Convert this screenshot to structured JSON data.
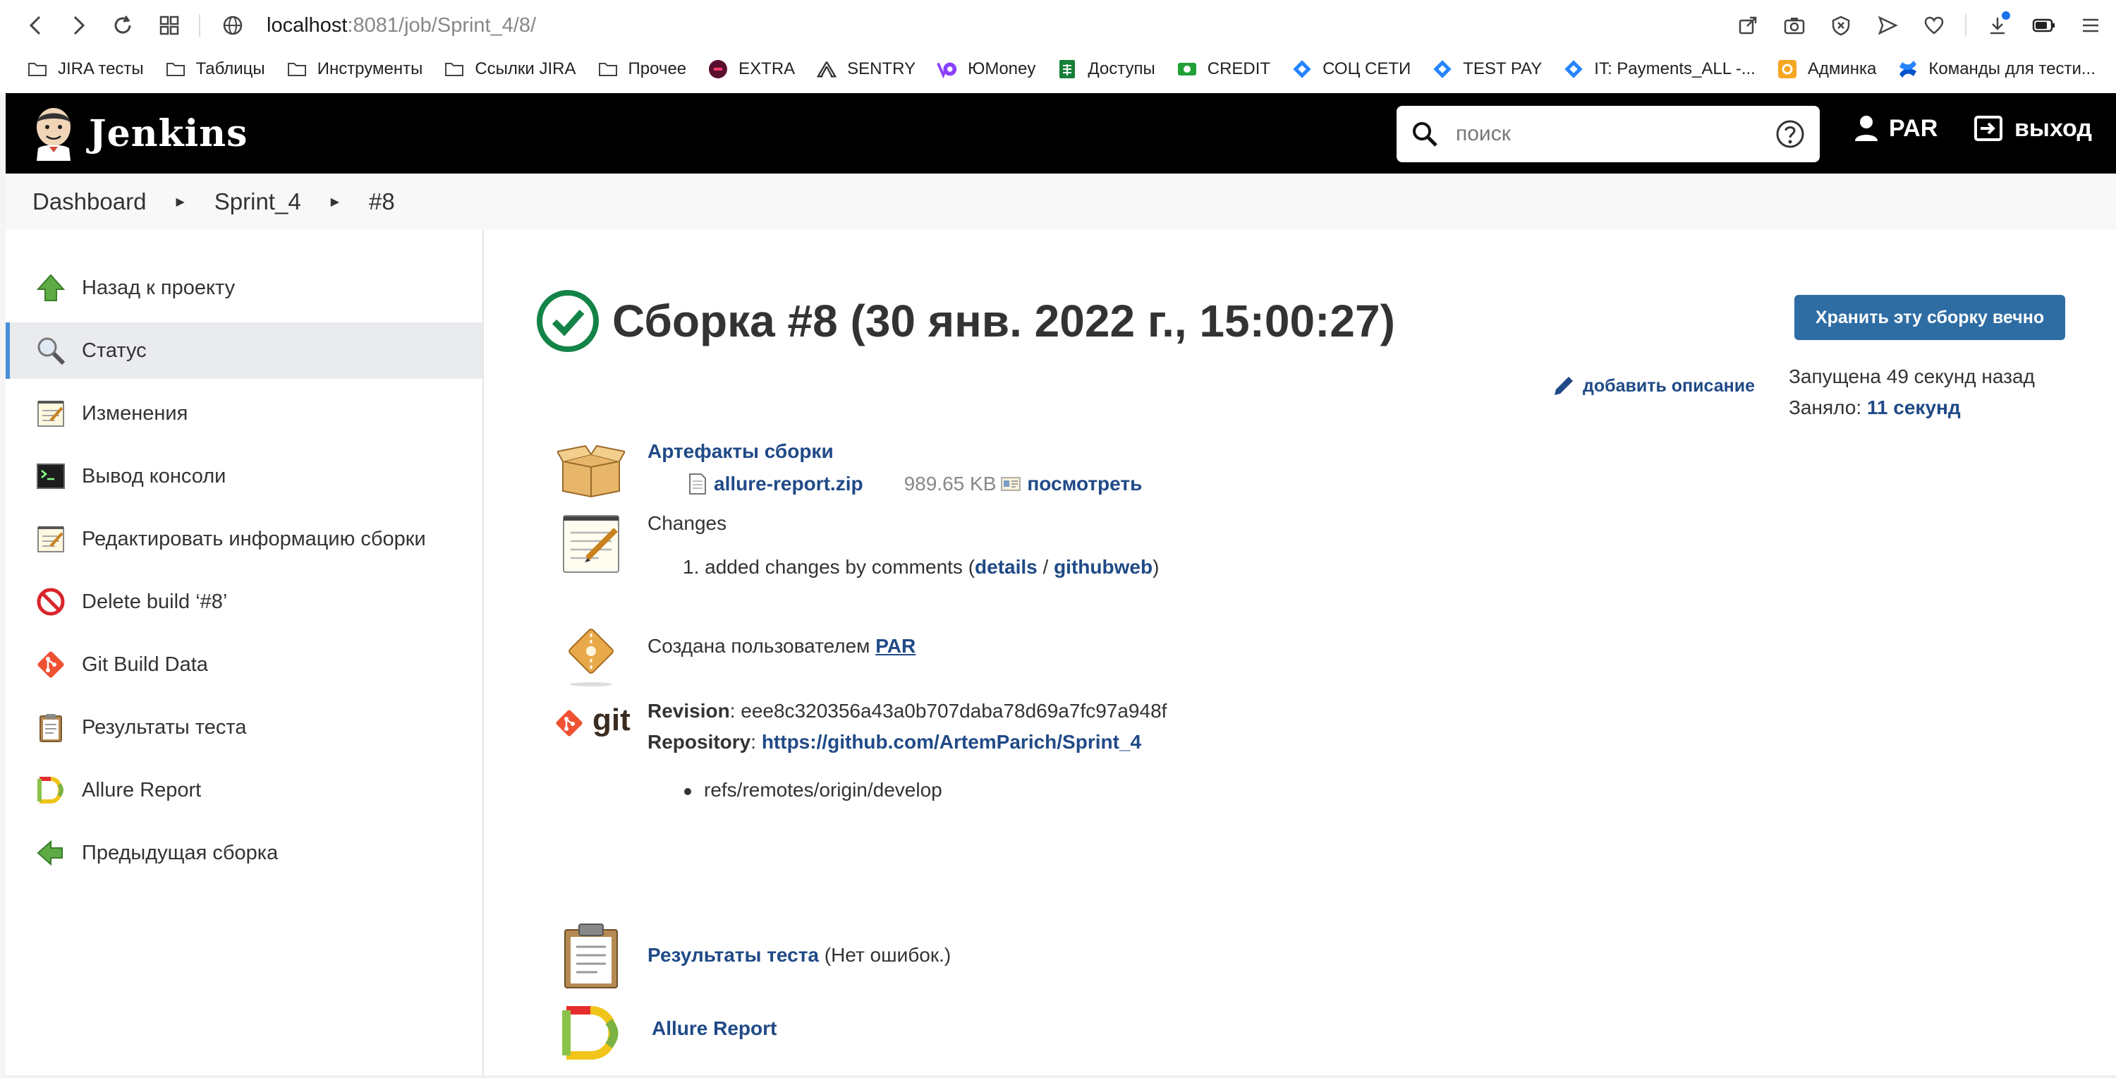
{
  "browser": {
    "url_host": "localhost",
    "url_path": ":8081/job/Sprint_4/8/",
    "bookmarks": [
      {
        "label": "JIRA тесты",
        "icon": "folder-icon"
      },
      {
        "label": "Таблицы",
        "icon": "folder-icon"
      },
      {
        "label": "Инструменты",
        "icon": "folder-icon"
      },
      {
        "label": "Ссылки JIRA",
        "icon": "folder-icon"
      },
      {
        "label": "Прочее",
        "icon": "folder-icon"
      },
      {
        "label": "EXTRA",
        "icon": "extra-icon"
      },
      {
        "label": "SENTRY",
        "icon": "sentry-icon"
      },
      {
        "label": "ЮMoney",
        "icon": "yoomoney-icon"
      },
      {
        "label": "Доступы",
        "icon": "sheets-icon"
      },
      {
        "label": "CREDIT",
        "icon": "credit-icon"
      },
      {
        "label": "СОЦ СЕТИ",
        "icon": "jira-icon"
      },
      {
        "label": "TEST PAY",
        "icon": "jira-icon"
      },
      {
        "label": "IT: Payments_ALL -...",
        "icon": "jira-icon"
      },
      {
        "label": "Админка",
        "icon": "admin-icon"
      },
      {
        "label": "Команды для тести...",
        "icon": "confluence-icon"
      }
    ]
  },
  "header": {
    "title": "Jenkins",
    "search_placeholder": "поиск",
    "user": "PAR",
    "logout": "выход"
  },
  "breadcrumb": [
    "Dashboard",
    "Sprint_4",
    "#8"
  ],
  "sidebar": {
    "items": [
      {
        "label": "Назад к проекту",
        "icon": "up-arrow-icon"
      },
      {
        "label": "Статус",
        "icon": "search-icon"
      },
      {
        "label": "Изменения",
        "icon": "notepad-icon"
      },
      {
        "label": "Вывод консоли",
        "icon": "terminal-icon"
      },
      {
        "label": "Редактировать информацию сборки",
        "icon": "notepad-icon"
      },
      {
        "label": "Delete build ‘#8’",
        "icon": "no-entry-icon"
      },
      {
        "label": "Git Build Data",
        "icon": "git-icon"
      },
      {
        "label": "Результаты теста",
        "icon": "clipboard-icon"
      },
      {
        "label": "Allure Report",
        "icon": "allure-icon"
      },
      {
        "label": "Предыдущая сборка",
        "icon": "back-arrow-icon"
      }
    ]
  },
  "build": {
    "title": "Сборка #8 (30 янв. 2022 г., 15:00:27)",
    "keep_button": "Хранить эту сборку вечно",
    "add_description": "добавить описание",
    "started": "Запущена 49 секунд назад",
    "took_label": "Заняло:",
    "took_value": "11 секунд"
  },
  "artifacts": {
    "heading": "Артефакты сборки",
    "file": "allure-report.zip",
    "size": "989.65 KB",
    "view": "посмотреть"
  },
  "changes": {
    "heading": "Changes",
    "item_number": "1.",
    "item_text": "added changes by comments (",
    "details": "details",
    "slash": " / ",
    "githubweb": "githubweb",
    "close": ")"
  },
  "cause": {
    "text": "Создана пользователем",
    "user": "PAR"
  },
  "git": {
    "revision_label": "Revision",
    "revision": ": eee8c320356a43a0b707daba78d69a7fc97a948f",
    "repository_label": "Repository",
    "repository_sep": ": ",
    "repository": "https://github.com/ArtemParich/Sprint_4",
    "branch": "refs/remotes/origin/develop",
    "logo_text": "git"
  },
  "tests": {
    "link": "Результаты теста",
    "note": " (Нет ошибок.)"
  },
  "allure": {
    "link": "Allure Report"
  }
}
